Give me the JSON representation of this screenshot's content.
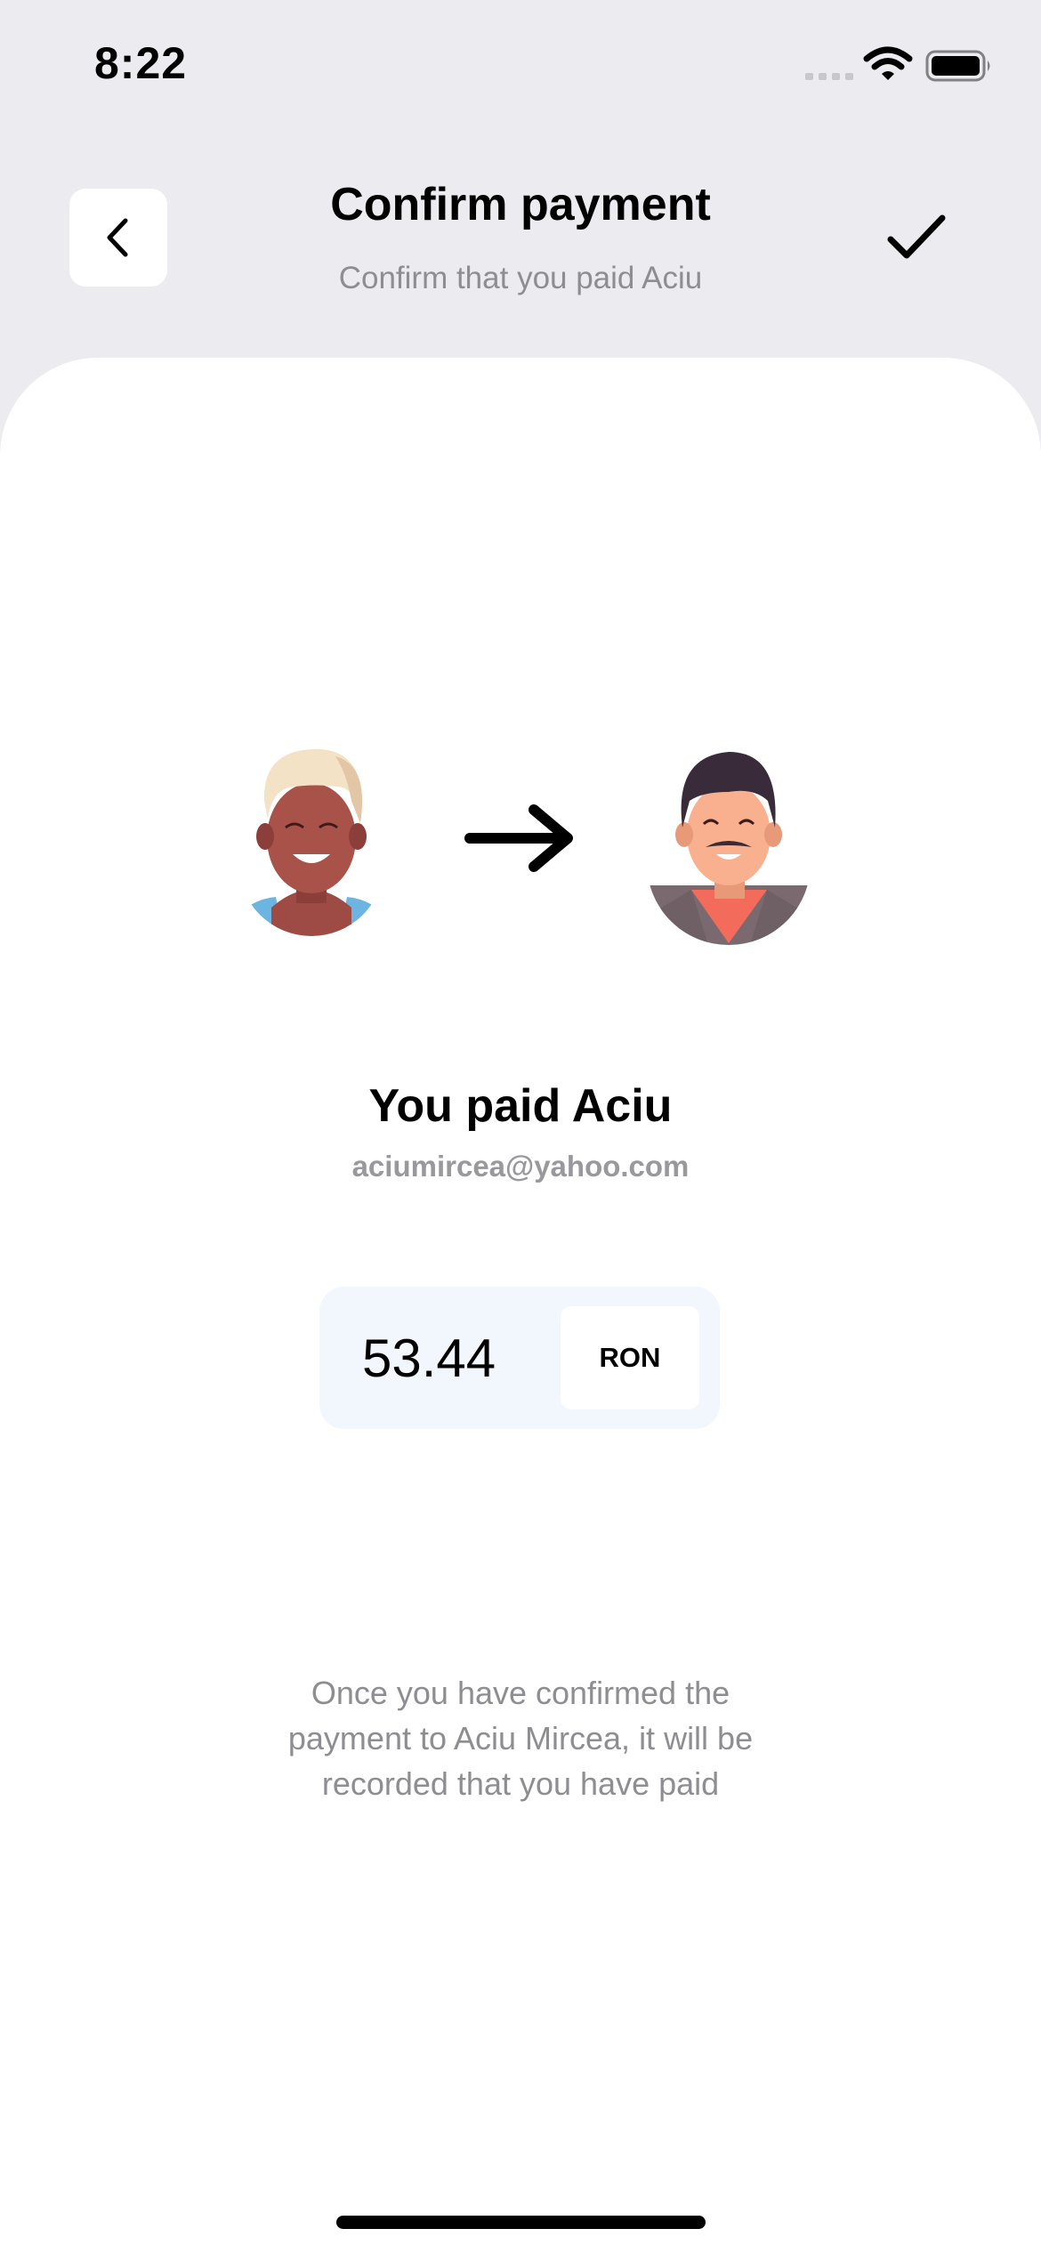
{
  "status_bar": {
    "time": "8:22",
    "icons": [
      "signal-icon",
      "wifi-icon",
      "battery-icon"
    ]
  },
  "header": {
    "back_icon": "chevron-left-icon",
    "title": "Confirm payment",
    "subtitle": "Confirm that you paid Aciu",
    "confirm_icon": "checkmark-icon"
  },
  "transfer": {
    "payer_avatar": "avatar-payer",
    "arrow_icon": "arrow-right-icon",
    "payee_avatar": "avatar-payee"
  },
  "recipient": {
    "title": "You paid Aciu",
    "email": "aciumircea@yahoo.com"
  },
  "amount": {
    "value": "53.44",
    "currency": "RON"
  },
  "info": {
    "text": "Once you have confirmed the\npayment to Aciu Mircea, it will be\nrecorded that you have paid"
  },
  "colors": {
    "background": "#ebebf0",
    "card": "#ffffff",
    "amount_box": "#f2f6fd",
    "secondary_text": "#8d8d92"
  }
}
